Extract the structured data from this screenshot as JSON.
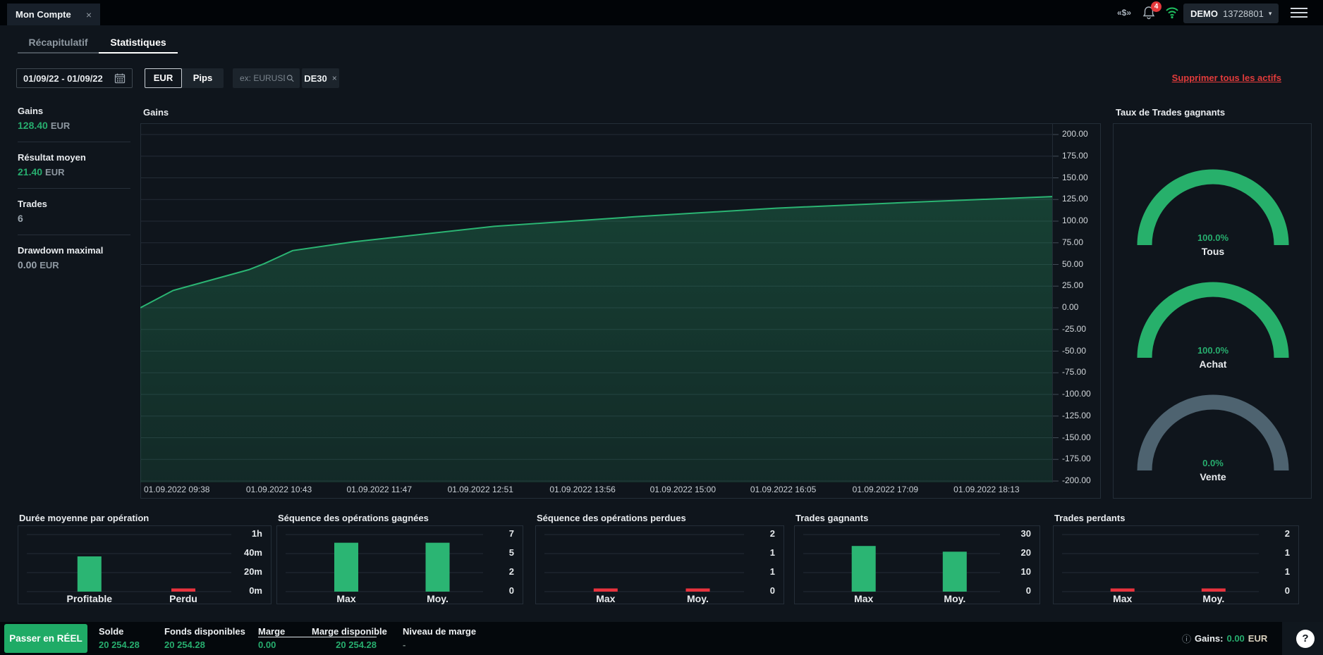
{
  "topbar": {
    "tab_title": "Mon Compte",
    "close_glyph": "×",
    "dollar_glyph": "«$»",
    "notification_count": "4",
    "account_type": "DEMO",
    "account_number": "13728801",
    "caret_glyph": "▾"
  },
  "nav_tabs": {
    "recap": "Récapitulatif",
    "stats": "Statistiques"
  },
  "filters": {
    "date_range": "01/09/22 - 01/09/22",
    "currency_btn": "EUR",
    "pips_btn": "Pips",
    "search_placeholder": "ex: EURUSD",
    "asset_chip": "DE30",
    "chip_close": "×",
    "clear_link": "Supprimer tous les actifs"
  },
  "summary": {
    "items": [
      {
        "label": "Gains",
        "value": "128.40",
        "unit": "EUR",
        "tone": "green"
      },
      {
        "label": "Résultat moyen",
        "value": "21.40",
        "unit": "EUR",
        "tone": "green"
      },
      {
        "label": "Trades",
        "value": "6",
        "unit": "",
        "tone": "muted"
      },
      {
        "label": "Drawdown maximal",
        "value": "0.00",
        "unit": "EUR",
        "tone": "muted"
      }
    ]
  },
  "bottombar": {
    "cta": "Passer en RÉEL",
    "stats": [
      {
        "label": "Solde",
        "value": "20 254.28"
      },
      {
        "label": "Fonds disponibles",
        "value": "20 254.28"
      },
      {
        "label": "Marge",
        "value": "0.00"
      },
      {
        "label": "Marge disponible",
        "value": "20 254.28"
      },
      {
        "label": "Niveau de marge",
        "value": "-"
      }
    ],
    "info_glyph": "ⓘ",
    "gains_label": "Gains:",
    "gains_value": "0.00",
    "gains_unit": "EUR",
    "help_glyph": "?"
  },
  "chart_data": [
    {
      "id": "gains_curve",
      "type": "area",
      "title": "Gains",
      "ylabel": "EUR",
      "ylim": [
        -200,
        200
      ],
      "ytick_step": 25,
      "grid": true,
      "line_color": "#2bb573",
      "yticks": [
        "200.00",
        "175.00",
        "150.00",
        "125.00",
        "100.00",
        "75.00",
        "50.00",
        "25.00",
        "0.00",
        "-25.00",
        "-50.00",
        "-75.00",
        "-100.00",
        "-125.00",
        "-150.00",
        "-175.00",
        "-200.00"
      ],
      "xticks": [
        "01.09.2022 09:38",
        "01.09.2022 10:43",
        "01.09.2022 11:47",
        "01.09.2022 12:51",
        "01.09.2022 13:56",
        "01.09.2022 15:00",
        "01.09.2022 16:05",
        "01.09.2022 17:09",
        "01.09.2022 18:13"
      ],
      "points": [
        [
          0,
          0
        ],
        [
          0.036,
          20
        ],
        [
          0.119,
          44
        ],
        [
          0.136,
          51
        ],
        [
          0.167,
          66
        ],
        [
          0.233,
          76
        ],
        [
          0.388,
          94
        ],
        [
          0.542,
          105
        ],
        [
          0.697,
          115
        ],
        [
          0.851,
          122
        ],
        [
          1,
          128.4
        ]
      ]
    },
    {
      "id": "win_rate_gauges",
      "type": "gauge",
      "title": "Taux de Trades gagnants",
      "items": [
        {
          "label": "Tous",
          "value_text": "100.0%",
          "value": 100.0,
          "arc": "green"
        },
        {
          "label": "Achat",
          "value_text": "100.0%",
          "value": 100.0,
          "arc": "green"
        },
        {
          "label": "Vente",
          "value_text": "0.0%",
          "value": 0.0,
          "arc": "gray"
        }
      ]
    },
    {
      "id": "avg_duration",
      "type": "bar",
      "title": "Durée moyenne par opération",
      "categories": [
        "Profitable",
        "Perdu"
      ],
      "values": [
        37,
        1
      ],
      "unit": "minutes",
      "ymax": 60,
      "yticks": [
        "1h",
        "40m",
        "20m",
        "0m"
      ],
      "colors": [
        "green",
        "red"
      ]
    },
    {
      "id": "win_streak",
      "type": "bar",
      "title": "Séquence des opérations gagnées",
      "categories": [
        "Max",
        "Moy."
      ],
      "values": [
        6,
        6
      ],
      "ymax": 7,
      "yticks": [
        "7",
        "5",
        "2",
        "0"
      ],
      "colors": [
        "green",
        "green"
      ]
    },
    {
      "id": "lose_streak",
      "type": "bar",
      "title": "Séquence des opérations perdues",
      "categories": [
        "Max",
        "Moy."
      ],
      "values": [
        0,
        0
      ],
      "ymax": 2,
      "yticks": [
        "2",
        "1",
        "1",
        "0"
      ],
      "colors": [
        "red",
        "red"
      ]
    },
    {
      "id": "winning_trades",
      "type": "bar",
      "title": "Trades gagnants",
      "categories": [
        "Max",
        "Moy."
      ],
      "values": [
        24,
        21
      ],
      "ymax": 30,
      "yticks": [
        "30",
        "20",
        "10",
        "0"
      ],
      "colors": [
        "green",
        "green"
      ]
    },
    {
      "id": "losing_trades",
      "type": "bar",
      "title": "Trades perdants",
      "categories": [
        "Max",
        "Moy."
      ],
      "values": [
        0,
        0
      ],
      "ymax": 2,
      "yticks": [
        "2",
        "1",
        "1",
        "0"
      ],
      "colors": [
        "red",
        "red"
      ]
    }
  ]
}
